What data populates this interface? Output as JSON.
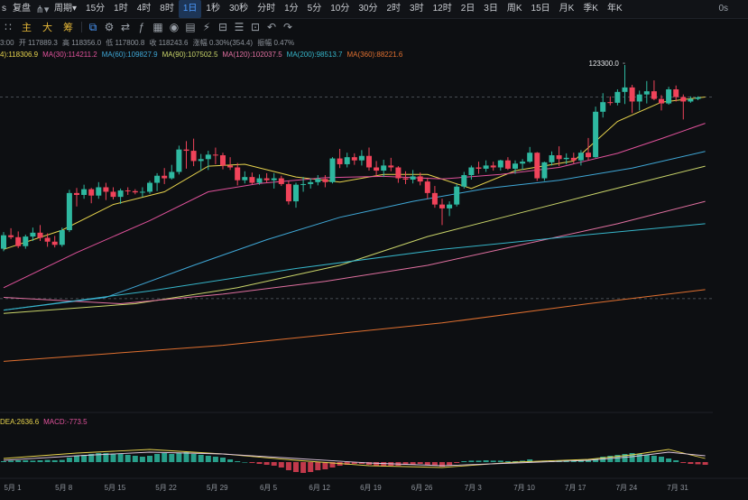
{
  "toolbar": {
    "prefix": "s",
    "fuquan": "复盘",
    "chart_type_icon": "candlestick-icon",
    "period_label": "周期",
    "periods": [
      "15分",
      "1时",
      "4时",
      "8时",
      "1日",
      "1秒",
      "30秒",
      "分时",
      "1分",
      "5分",
      "10分",
      "30分",
      "2时",
      "3时",
      "12时",
      "2日",
      "3日",
      "周K",
      "15日",
      "月K",
      "季K",
      "年K"
    ],
    "active_period": "1日",
    "right_value": "0s"
  },
  "toolbar2": {
    "tabs": [
      "主",
      "大",
      "筹"
    ],
    "icons": [
      "candle-icon",
      "settings-icon",
      "compare-icon",
      "indicator-icon",
      "calendar-icon",
      "camera-icon",
      "print-icon",
      "chart-tool-icon",
      "ruler-icon",
      "layers-icon",
      "template-icon",
      "undo-icon",
      "redo-icon"
    ]
  },
  "ohlc": {
    "time_suffix": "3:00",
    "open": "开 117889.3",
    "high": "高 118356.0",
    "low": "低 117800.8",
    "close": "收 118243.6",
    "change": "涨幅 0.30%(354.4)",
    "amplitude": "振幅 0.47%"
  },
  "ma_legend": [
    {
      "text": "4):118306.9",
      "color": "#e8d44d"
    },
    {
      "text": "MA(30):114211.2",
      "color": "#e0529b"
    },
    {
      "text": "MA(60):109827.9",
      "color": "#3fa7d6"
    },
    {
      "text": "MA(90):107502.5",
      "color": "#c9d46a"
    },
    {
      "text": "MA(120):102037.5",
      "color": "#e070a0"
    },
    {
      "text": "MA(200):98513.7",
      "color": "#36b5c9"
    },
    {
      "text": "MA(360):88221.6",
      "color": "#e07030"
    }
  ],
  "macd_legend": [
    {
      "text": "DEA:2636.6",
      "color": "#e8d44d"
    },
    {
      "text": "MACD:-773.5",
      "color": "#e0529b"
    }
  ],
  "annotation": "123300.0",
  "chart_data": {
    "type": "candlestick",
    "x_tick_labels": [
      "5月 1",
      "5月 8",
      "5月 15",
      "5月 22",
      "5月 29",
      "6月 5",
      "6月 12",
      "6月 19",
      "6月 26",
      "7月 3",
      "7月 10",
      "7月 17",
      "7月 24",
      "7月 31"
    ],
    "candles": [
      {
        "o": 94600,
        "h": 97200,
        "l": 94200,
        "c": 96700
      },
      {
        "o": 96700,
        "h": 97800,
        "l": 96100,
        "c": 96400
      },
      {
        "o": 96400,
        "h": 97300,
        "l": 94700,
        "c": 95000
      },
      {
        "o": 95000,
        "h": 96800,
        "l": 94600,
        "c": 96500
      },
      {
        "o": 96500,
        "h": 97900,
        "l": 95800,
        "c": 97100
      },
      {
        "o": 97100,
        "h": 98300,
        "l": 95800,
        "c": 96300
      },
      {
        "o": 96300,
        "h": 97000,
        "l": 94900,
        "c": 95700
      },
      {
        "o": 95700,
        "h": 96600,
        "l": 94800,
        "c": 95200
      },
      {
        "o": 95200,
        "h": 97900,
        "l": 94900,
        "c": 97500
      },
      {
        "o": 97500,
        "h": 103800,
        "l": 97200,
        "c": 103300
      },
      {
        "o": 103300,
        "h": 104100,
        "l": 101200,
        "c": 103000
      },
      {
        "o": 103000,
        "h": 104600,
        "l": 102400,
        "c": 103900
      },
      {
        "o": 103900,
        "h": 104100,
        "l": 101700,
        "c": 102900
      },
      {
        "o": 102900,
        "h": 105000,
        "l": 102400,
        "c": 104200
      },
      {
        "o": 104200,
        "h": 104900,
        "l": 102200,
        "c": 103500
      },
      {
        "o": 103500,
        "h": 104200,
        "l": 102300,
        "c": 102700
      },
      {
        "o": 102700,
        "h": 104000,
        "l": 101600,
        "c": 103700
      },
      {
        "o": 103700,
        "h": 104200,
        "l": 103000,
        "c": 103600
      },
      {
        "o": 103600,
        "h": 103900,
        "l": 103100,
        "c": 103400
      },
      {
        "o": 103400,
        "h": 104200,
        "l": 102700,
        "c": 103500
      },
      {
        "o": 103500,
        "h": 105200,
        "l": 103200,
        "c": 104900
      },
      {
        "o": 104900,
        "h": 106400,
        "l": 103600,
        "c": 106000
      },
      {
        "o": 106000,
        "h": 107200,
        "l": 104700,
        "c": 105600
      },
      {
        "o": 105600,
        "h": 107700,
        "l": 105400,
        "c": 106600
      },
      {
        "o": 106600,
        "h": 110700,
        "l": 106200,
        "c": 110100
      },
      {
        "o": 110100,
        "h": 111400,
        "l": 107100,
        "c": 109900
      },
      {
        "o": 109900,
        "h": 111800,
        "l": 107500,
        "c": 108300
      },
      {
        "o": 108300,
        "h": 109400,
        "l": 106800,
        "c": 108600
      },
      {
        "o": 108600,
        "h": 109900,
        "l": 106900,
        "c": 109300
      },
      {
        "o": 109300,
        "h": 110400,
        "l": 107800,
        "c": 109200
      },
      {
        "o": 109200,
        "h": 109600,
        "l": 107000,
        "c": 107600
      },
      {
        "o": 107600,
        "h": 108900,
        "l": 106900,
        "c": 107300
      },
      {
        "o": 107300,
        "h": 108000,
        "l": 104500,
        "c": 105300
      },
      {
        "o": 105300,
        "h": 106700,
        "l": 104800,
        "c": 105800
      },
      {
        "o": 105800,
        "h": 106500,
        "l": 104700,
        "c": 104900
      },
      {
        "o": 104900,
        "h": 106200,
        "l": 104600,
        "c": 105600
      },
      {
        "o": 105600,
        "h": 106400,
        "l": 104900,
        "c": 105300
      },
      {
        "o": 105300,
        "h": 106400,
        "l": 104000,
        "c": 105600
      },
      {
        "o": 105600,
        "h": 106000,
        "l": 104400,
        "c": 104700
      },
      {
        "o": 104700,
        "h": 105200,
        "l": 101500,
        "c": 102000
      },
      {
        "o": 102000,
        "h": 104900,
        "l": 101000,
        "c": 104600
      },
      {
        "o": 104600,
        "h": 105800,
        "l": 103500,
        "c": 104700
      },
      {
        "o": 104700,
        "h": 105600,
        "l": 104000,
        "c": 105000
      },
      {
        "o": 105000,
        "h": 106100,
        "l": 104500,
        "c": 105500
      },
      {
        "o": 105500,
        "h": 106100,
        "l": 104200,
        "c": 105000
      },
      {
        "o": 105000,
        "h": 108900,
        "l": 104800,
        "c": 108700
      },
      {
        "o": 108700,
        "h": 110200,
        "l": 107200,
        "c": 107800
      },
      {
        "o": 107800,
        "h": 109600,
        "l": 107300,
        "c": 108900
      },
      {
        "o": 108900,
        "h": 109500,
        "l": 107700,
        "c": 108400
      },
      {
        "o": 108400,
        "h": 110000,
        "l": 107600,
        "c": 109100
      },
      {
        "o": 109100,
        "h": 110400,
        "l": 106800,
        "c": 107300
      },
      {
        "o": 107300,
        "h": 108300,
        "l": 105900,
        "c": 106800
      },
      {
        "o": 106800,
        "h": 108500,
        "l": 105800,
        "c": 107600
      },
      {
        "o": 107600,
        "h": 108800,
        "l": 106700,
        "c": 107300
      },
      {
        "o": 107300,
        "h": 107500,
        "l": 104900,
        "c": 105600
      },
      {
        "o": 105600,
        "h": 106700,
        "l": 104700,
        "c": 105400
      },
      {
        "o": 105400,
        "h": 106900,
        "l": 104800,
        "c": 105900
      },
      {
        "o": 105900,
        "h": 106500,
        "l": 104500,
        "c": 105100
      },
      {
        "o": 105100,
        "h": 105700,
        "l": 102400,
        "c": 103300
      },
      {
        "o": 103300,
        "h": 104400,
        "l": 101000,
        "c": 101500
      },
      {
        "o": 101500,
        "h": 102400,
        "l": 98300,
        "c": 100900
      },
      {
        "o": 100900,
        "h": 102000,
        "l": 99700,
        "c": 101500
      },
      {
        "o": 101500,
        "h": 104700,
        "l": 101200,
        "c": 104300
      },
      {
        "o": 104300,
        "h": 106600,
        "l": 104000,
        "c": 106100
      },
      {
        "o": 106100,
        "h": 107600,
        "l": 105400,
        "c": 107300
      },
      {
        "o": 107300,
        "h": 108200,
        "l": 106300,
        "c": 107100
      },
      {
        "o": 107100,
        "h": 108400,
        "l": 106600,
        "c": 107600
      },
      {
        "o": 107600,
        "h": 108200,
        "l": 106800,
        "c": 107300
      },
      {
        "o": 107300,
        "h": 108500,
        "l": 106800,
        "c": 108400
      },
      {
        "o": 108400,
        "h": 108900,
        "l": 106900,
        "c": 107100
      },
      {
        "o": 107100,
        "h": 108400,
        "l": 106300,
        "c": 107900
      },
      {
        "o": 107900,
        "h": 108600,
        "l": 106900,
        "c": 108200
      },
      {
        "o": 108200,
        "h": 110500,
        "l": 108000,
        "c": 109600
      },
      {
        "o": 109600,
        "h": 109700,
        "l": 105200,
        "c": 105600
      },
      {
        "o": 105600,
        "h": 108200,
        "l": 105200,
        "c": 108100
      },
      {
        "o": 108100,
        "h": 109800,
        "l": 107600,
        "c": 109200
      },
      {
        "o": 109200,
        "h": 110600,
        "l": 107500,
        "c": 108600
      },
      {
        "o": 108600,
        "h": 109500,
        "l": 107800,
        "c": 108800
      },
      {
        "o": 108800,
        "h": 109600,
        "l": 107900,
        "c": 108400
      },
      {
        "o": 108400,
        "h": 110000,
        "l": 107600,
        "c": 109600
      },
      {
        "o": 109600,
        "h": 111900,
        "l": 108400,
        "c": 108900
      },
      {
        "o": 108900,
        "h": 116800,
        "l": 108800,
        "c": 116000
      },
      {
        "o": 116000,
        "h": 118900,
        "l": 115100,
        "c": 117500
      },
      {
        "o": 117500,
        "h": 118400,
        "l": 117000,
        "c": 117400
      },
      {
        "o": 117400,
        "h": 119500,
        "l": 117000,
        "c": 119100
      },
      {
        "o": 119100,
        "h": 123300,
        "l": 117200,
        "c": 119800
      },
      {
        "o": 119800,
        "h": 120200,
        "l": 115800,
        "c": 117600
      },
      {
        "o": 117600,
        "h": 119300,
        "l": 116200,
        "c": 118700
      },
      {
        "o": 118700,
        "h": 120800,
        "l": 117300,
        "c": 119200
      },
      {
        "o": 119200,
        "h": 120900,
        "l": 117800,
        "c": 118000
      },
      {
        "o": 118000,
        "h": 118600,
        "l": 116200,
        "c": 117300
      },
      {
        "o": 117300,
        "h": 119900,
        "l": 117100,
        "c": 119500
      },
      {
        "o": 119500,
        "h": 120100,
        "l": 117600,
        "c": 118300
      },
      {
        "o": 118300,
        "h": 118700,
        "l": 114800,
        "c": 117600
      },
      {
        "o": 117600,
        "h": 118400,
        "l": 117400,
        "c": 118000
      },
      {
        "o": 118000,
        "h": 118400,
        "l": 117800,
        "c": 118244
      }
    ],
    "series": [
      {
        "color": "#e8d44d",
        "values": [
          [
            0,
            94500
          ],
          [
            8,
            97500
          ],
          [
            15,
            101500
          ],
          [
            22,
            103500
          ],
          [
            28,
            107500
          ],
          [
            33,
            107800
          ],
          [
            40,
            105800
          ],
          [
            46,
            105000
          ],
          [
            52,
            106200
          ],
          [
            58,
            106200
          ],
          [
            64,
            104000
          ],
          [
            70,
            106800
          ],
          [
            78,
            108300
          ],
          [
            84,
            114500
          ],
          [
            90,
            117500
          ],
          [
            96,
            118300
          ]
        ]
      },
      {
        "color": "#e0529b",
        "values": [
          [
            0,
            88500
          ],
          [
            10,
            94000
          ],
          [
            20,
            99000
          ],
          [
            28,
            103500
          ],
          [
            35,
            104800
          ],
          [
            44,
            105700
          ],
          [
            52,
            105900
          ],
          [
            60,
            105500
          ],
          [
            68,
            106200
          ],
          [
            76,
            107300
          ],
          [
            84,
            109500
          ],
          [
            90,
            111800
          ],
          [
            96,
            114200
          ]
        ]
      },
      {
        "color": "#3fa7d6",
        "values": [
          [
            0,
            85000
          ],
          [
            14,
            87000
          ],
          [
            26,
            92000
          ],
          [
            36,
            96000
          ],
          [
            46,
            99500
          ],
          [
            56,
            102000
          ],
          [
            66,
            104000
          ],
          [
            76,
            105300
          ],
          [
            86,
            107200
          ],
          [
            96,
            109800
          ]
        ]
      },
      {
        "color": "#c9d46a",
        "values": [
          [
            0,
            84500
          ],
          [
            18,
            86000
          ],
          [
            32,
            88500
          ],
          [
            46,
            92000
          ],
          [
            58,
            96500
          ],
          [
            70,
            100000
          ],
          [
            82,
            103500
          ],
          [
            96,
            107500
          ]
        ]
      },
      {
        "color": "#e070a0",
        "values": [
          [
            0,
            87000
          ],
          [
            16,
            86000
          ],
          [
            30,
            87500
          ],
          [
            44,
            89500
          ],
          [
            58,
            92000
          ],
          [
            70,
            95000
          ],
          [
            84,
            98500
          ],
          [
            96,
            102000
          ]
        ]
      },
      {
        "color": "#36b5c9",
        "values": [
          [
            0,
            85000
          ],
          [
            20,
            88000
          ],
          [
            40,
            91500
          ],
          [
            60,
            94500
          ],
          [
            80,
            96800
          ],
          [
            96,
            98500
          ]
        ]
      },
      {
        "color": "#e07030",
        "values": [
          [
            0,
            77000
          ],
          [
            30,
            79500
          ],
          [
            60,
            83000
          ],
          [
            80,
            86000
          ],
          [
            96,
            88200
          ]
        ]
      }
    ],
    "dashed_levels": [
      118300,
      86800
    ],
    "macd": {
      "dif": [
        [
          0,
          0.2
        ],
        [
          10,
          0.5
        ],
        [
          20,
          0.7
        ],
        [
          30,
          0.45
        ],
        [
          40,
          0.1
        ],
        [
          50,
          -0.2
        ],
        [
          60,
          -0.3
        ],
        [
          70,
          0.0
        ],
        [
          80,
          0.15
        ],
        [
          86,
          0.4
        ],
        [
          91,
          0.7
        ],
        [
          96,
          0.2
        ]
      ],
      "dea": [
        [
          0,
          0.1
        ],
        [
          10,
          0.35
        ],
        [
          20,
          0.55
        ],
        [
          30,
          0.45
        ],
        [
          40,
          0.2
        ],
        [
          50,
          -0.05
        ],
        [
          60,
          -0.2
        ],
        [
          70,
          -0.05
        ],
        [
          80,
          0.1
        ],
        [
          86,
          0.3
        ],
        [
          91,
          0.55
        ],
        [
          96,
          0.35
        ]
      ],
      "hist": [
        0.05,
        0.08,
        0.1,
        0.1,
        0.08,
        0.1,
        0.12,
        0.1,
        0.12,
        0.25,
        0.35,
        0.4,
        0.45,
        0.5,
        0.5,
        0.45,
        0.45,
        0.4,
        0.35,
        0.3,
        0.35,
        0.45,
        0.5,
        0.45,
        0.5,
        0.55,
        0.45,
        0.4,
        0.35,
        0.3,
        0.25,
        0.15,
        0.05,
        0.0,
        -0.05,
        -0.1,
        -0.15,
        -0.2,
        -0.3,
        -0.45,
        -0.55,
        -0.6,
        -0.55,
        -0.45,
        -0.4,
        -0.3,
        -0.2,
        -0.15,
        -0.1,
        -0.1,
        -0.15,
        -0.2,
        -0.25,
        -0.2,
        -0.2,
        -0.15,
        -0.15,
        -0.1,
        -0.15,
        -0.2,
        -0.25,
        -0.2,
        -0.05,
        0.05,
        0.08,
        0.08,
        0.1,
        0.08,
        0.08,
        0.05,
        0.05,
        0.08,
        0.15,
        0.05,
        0.08,
        0.1,
        0.08,
        0.1,
        0.12,
        0.12,
        0.12,
        0.2,
        0.3,
        0.35,
        0.4,
        0.45,
        0.5,
        0.45,
        0.4,
        0.35,
        0.3,
        0.2,
        0.1,
        -0.05,
        -0.1,
        -0.12,
        -0.15
      ]
    }
  }
}
